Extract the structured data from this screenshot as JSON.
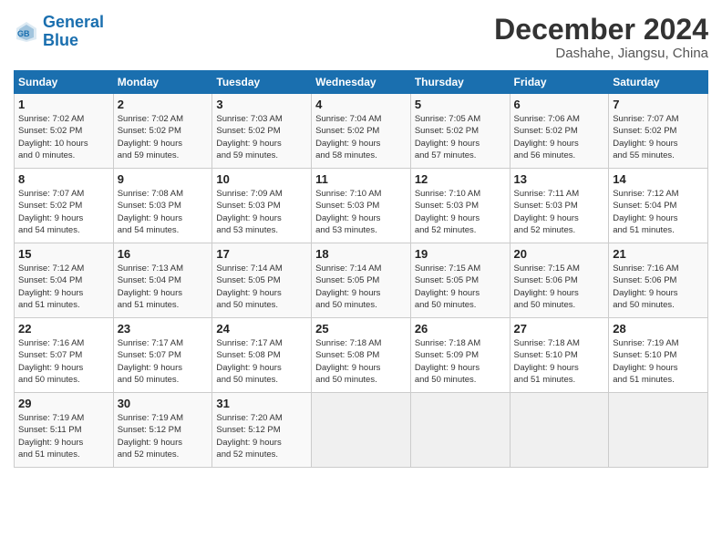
{
  "header": {
    "logo_line1": "General",
    "logo_line2": "Blue",
    "month_title": "December 2024",
    "location": "Dashahe, Jiangsu, China"
  },
  "weekdays": [
    "Sunday",
    "Monday",
    "Tuesday",
    "Wednesday",
    "Thursday",
    "Friday",
    "Saturday"
  ],
  "weeks": [
    [
      {
        "day": "1",
        "sunrise": "7:02 AM",
        "sunset": "5:02 PM",
        "daylight": "10 hours and 0 minutes."
      },
      {
        "day": "2",
        "sunrise": "7:02 AM",
        "sunset": "5:02 PM",
        "daylight": "9 hours and 59 minutes."
      },
      {
        "day": "3",
        "sunrise": "7:03 AM",
        "sunset": "5:02 PM",
        "daylight": "9 hours and 59 minutes."
      },
      {
        "day": "4",
        "sunrise": "7:04 AM",
        "sunset": "5:02 PM",
        "daylight": "9 hours and 58 minutes."
      },
      {
        "day": "5",
        "sunrise": "7:05 AM",
        "sunset": "5:02 PM",
        "daylight": "9 hours and 57 minutes."
      },
      {
        "day": "6",
        "sunrise": "7:06 AM",
        "sunset": "5:02 PM",
        "daylight": "9 hours and 56 minutes."
      },
      {
        "day": "7",
        "sunrise": "7:07 AM",
        "sunset": "5:02 PM",
        "daylight": "9 hours and 55 minutes."
      }
    ],
    [
      {
        "day": "8",
        "sunrise": "7:07 AM",
        "sunset": "5:02 PM",
        "daylight": "9 hours and 54 minutes."
      },
      {
        "day": "9",
        "sunrise": "7:08 AM",
        "sunset": "5:03 PM",
        "daylight": "9 hours and 54 minutes."
      },
      {
        "day": "10",
        "sunrise": "7:09 AM",
        "sunset": "5:03 PM",
        "daylight": "9 hours and 53 minutes."
      },
      {
        "day": "11",
        "sunrise": "7:10 AM",
        "sunset": "5:03 PM",
        "daylight": "9 hours and 53 minutes."
      },
      {
        "day": "12",
        "sunrise": "7:10 AM",
        "sunset": "5:03 PM",
        "daylight": "9 hours and 52 minutes."
      },
      {
        "day": "13",
        "sunrise": "7:11 AM",
        "sunset": "5:03 PM",
        "daylight": "9 hours and 52 minutes."
      },
      {
        "day": "14",
        "sunrise": "7:12 AM",
        "sunset": "5:04 PM",
        "daylight": "9 hours and 51 minutes."
      }
    ],
    [
      {
        "day": "15",
        "sunrise": "7:12 AM",
        "sunset": "5:04 PM",
        "daylight": "9 hours and 51 minutes."
      },
      {
        "day": "16",
        "sunrise": "7:13 AM",
        "sunset": "5:04 PM",
        "daylight": "9 hours and 51 minutes."
      },
      {
        "day": "17",
        "sunrise": "7:14 AM",
        "sunset": "5:05 PM",
        "daylight": "9 hours and 50 minutes."
      },
      {
        "day": "18",
        "sunrise": "7:14 AM",
        "sunset": "5:05 PM",
        "daylight": "9 hours and 50 minutes."
      },
      {
        "day": "19",
        "sunrise": "7:15 AM",
        "sunset": "5:05 PM",
        "daylight": "9 hours and 50 minutes."
      },
      {
        "day": "20",
        "sunrise": "7:15 AM",
        "sunset": "5:06 PM",
        "daylight": "9 hours and 50 minutes."
      },
      {
        "day": "21",
        "sunrise": "7:16 AM",
        "sunset": "5:06 PM",
        "daylight": "9 hours and 50 minutes."
      }
    ],
    [
      {
        "day": "22",
        "sunrise": "7:16 AM",
        "sunset": "5:07 PM",
        "daylight": "9 hours and 50 minutes."
      },
      {
        "day": "23",
        "sunrise": "7:17 AM",
        "sunset": "5:07 PM",
        "daylight": "9 hours and 50 minutes."
      },
      {
        "day": "24",
        "sunrise": "7:17 AM",
        "sunset": "5:08 PM",
        "daylight": "9 hours and 50 minutes."
      },
      {
        "day": "25",
        "sunrise": "7:18 AM",
        "sunset": "5:08 PM",
        "daylight": "9 hours and 50 minutes."
      },
      {
        "day": "26",
        "sunrise": "7:18 AM",
        "sunset": "5:09 PM",
        "daylight": "9 hours and 50 minutes."
      },
      {
        "day": "27",
        "sunrise": "7:18 AM",
        "sunset": "5:10 PM",
        "daylight": "9 hours and 51 minutes."
      },
      {
        "day": "28",
        "sunrise": "7:19 AM",
        "sunset": "5:10 PM",
        "daylight": "9 hours and 51 minutes."
      }
    ],
    [
      {
        "day": "29",
        "sunrise": "7:19 AM",
        "sunset": "5:11 PM",
        "daylight": "9 hours and 51 minutes."
      },
      {
        "day": "30",
        "sunrise": "7:19 AM",
        "sunset": "5:12 PM",
        "daylight": "9 hours and 52 minutes."
      },
      {
        "day": "31",
        "sunrise": "7:20 AM",
        "sunset": "5:12 PM",
        "daylight": "9 hours and 52 minutes."
      },
      null,
      null,
      null,
      null
    ]
  ]
}
